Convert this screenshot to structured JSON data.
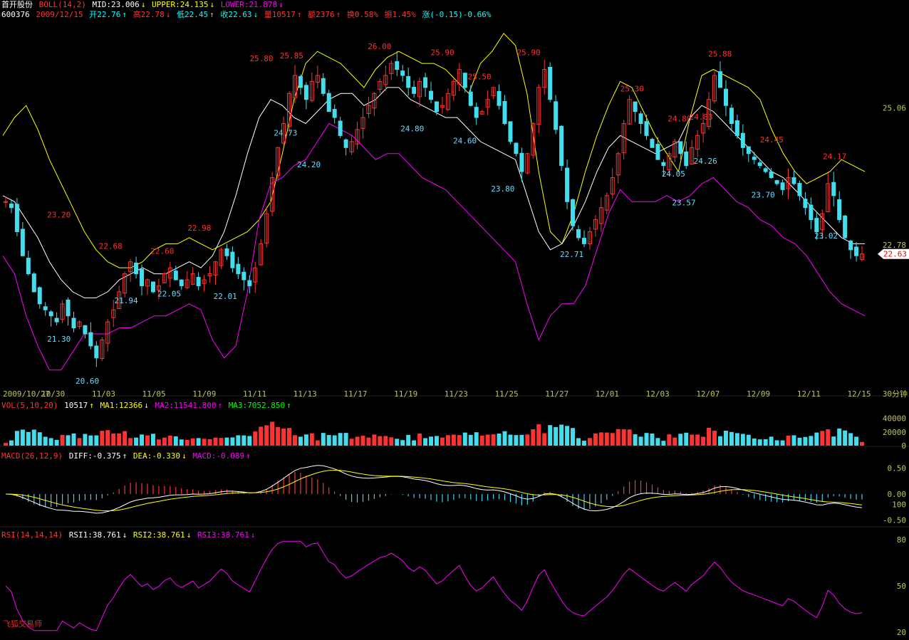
{
  "header": {
    "stock_name": "首开股份",
    "indicator": "BOLL(14,2)",
    "mid": "MID:23.006",
    "upper": "UPPER:24.135",
    "lower": "LOWER:21.878",
    "code": "600376",
    "date": "2009/12/15",
    "open": "开22.76",
    "high": "高22.78",
    "low": "低22.45",
    "close": "收22.63",
    "volume": "量10517",
    "amount": "额2376",
    "turnover": "换0.58%",
    "amplitude": "振1.45%",
    "change": "涨(-0.15)-0.66%"
  },
  "vol_header": {
    "name": "VOL(5,10,20)",
    "value": "10517",
    "ma1": "MA1:12366",
    "ma2": "MA2:11541.800",
    "ma3": "MA3:7052.850"
  },
  "macd_header": {
    "name": "MACD(26,12,9)",
    "diff": "DIFF:-0.375",
    "dea": "DEA:-0.330",
    "macd": "MACD:-0.089"
  },
  "rsi_header": {
    "name": "RSI(14,14,14)",
    "rsi1": "RSI1:38.761",
    "rsi2": "RSI2:38.761",
    "rsi3": "RSI3:38.761"
  },
  "period_label": "30分钟",
  "brand": "飞狐交易师",
  "colors": {
    "up": "#ff3333",
    "down": "#44ddee",
    "upper": "#ffff00",
    "mid": "#ffffff",
    "lower": "#ff00ff",
    "axis": "#c0c060",
    "macd_pos": "#ff3333",
    "macd_neg": "#44ccee"
  },
  "chart_data": [
    {
      "type": "candlestick",
      "name": "price",
      "x_labels": [
        "2009/10/27",
        "10/30",
        "11/03",
        "11/05",
        "11/09",
        "11/11",
        "11/13",
        "11/17",
        "11/19",
        "11/23",
        "11/25",
        "11/27",
        "12/01",
        "12/03",
        "12/07",
        "12/09",
        "12/11",
        "12/15"
      ],
      "ylim": [
        20.4,
        26.5
      ],
      "y_ticks": [
        25.06,
        22.78
      ],
      "current_price": 22.63,
      "extreme_labels": [
        {
          "text": "23.20",
          "kind": "high",
          "xi": 0.065,
          "v": 23.2
        },
        {
          "text": "21.30",
          "kind": "low",
          "xi": 0.065,
          "v": 21.3
        },
        {
          "text": "20.60",
          "kind": "low",
          "xi": 0.098,
          "v": 20.6
        },
        {
          "text": "22.68",
          "kind": "high",
          "xi": 0.125,
          "v": 22.68
        },
        {
          "text": "21.94",
          "kind": "low",
          "xi": 0.143,
          "v": 21.94
        },
        {
          "text": "22.60",
          "kind": "high",
          "xi": 0.185,
          "v": 22.6
        },
        {
          "text": "22.05",
          "kind": "low",
          "xi": 0.193,
          "v": 22.05
        },
        {
          "text": "22.98",
          "kind": "high",
          "xi": 0.228,
          "v": 22.98
        },
        {
          "text": "22.01",
          "kind": "low",
          "xi": 0.258,
          "v": 22.01
        },
        {
          "text": "25.80",
          "kind": "high",
          "xi": 0.3,
          "v": 25.8
        },
        {
          "text": "24.73",
          "kind": "low",
          "xi": 0.328,
          "v": 24.73
        },
        {
          "text": "25.85",
          "kind": "high",
          "xi": 0.335,
          "v": 25.85
        },
        {
          "text": "24.20",
          "kind": "low",
          "xi": 0.355,
          "v": 24.2
        },
        {
          "text": "26.00",
          "kind": "high",
          "xi": 0.437,
          "v": 26.0
        },
        {
          "text": "24.80",
          "kind": "low",
          "xi": 0.475,
          "v": 24.8
        },
        {
          "text": "25.90",
          "kind": "high",
          "xi": 0.51,
          "v": 25.9
        },
        {
          "text": "24.60",
          "kind": "low",
          "xi": 0.536,
          "v": 24.6
        },
        {
          "text": "25.50",
          "kind": "high",
          "xi": 0.553,
          "v": 25.5
        },
        {
          "text": "23.80",
          "kind": "low",
          "xi": 0.58,
          "v": 23.8
        },
        {
          "text": "25.90",
          "kind": "high",
          "xi": 0.61,
          "v": 25.9
        },
        {
          "text": "22.71",
          "kind": "low",
          "xi": 0.66,
          "v": 22.71
        },
        {
          "text": "25.30",
          "kind": "high",
          "xi": 0.73,
          "v": 25.3
        },
        {
          "text": "24.80",
          "kind": "high",
          "xi": 0.785,
          "v": 24.8
        },
        {
          "text": "24.05",
          "kind": "low",
          "xi": 0.778,
          "v": 24.05
        },
        {
          "text": "24.83",
          "kind": "high",
          "xi": 0.81,
          "v": 24.83
        },
        {
          "text": "23.57",
          "kind": "low",
          "xi": 0.79,
          "v": 23.57
        },
        {
          "text": "24.26",
          "kind": "low",
          "xi": 0.815,
          "v": 24.26
        },
        {
          "text": "25.88",
          "kind": "high",
          "xi": 0.832,
          "v": 25.88
        },
        {
          "text": "24.45",
          "kind": "high",
          "xi": 0.892,
          "v": 24.45
        },
        {
          "text": "23.70",
          "kind": "low",
          "xi": 0.882,
          "v": 23.7
        },
        {
          "text": "24.17",
          "kind": "high",
          "xi": 0.965,
          "v": 24.17
        },
        {
          "text": "23.02",
          "kind": "low",
          "xi": 0.955,
          "v": 23.02
        }
      ],
      "close_series": [
        23.5,
        23.4,
        23.0,
        22.6,
        22.3,
        22.0,
        21.8,
        21.7,
        21.6,
        21.5,
        21.8,
        21.6,
        21.4,
        21.5,
        21.3,
        21.1,
        20.9,
        21.2,
        21.5,
        21.7,
        22.0,
        22.3,
        22.5,
        22.3,
        22.1,
        22.2,
        22.0,
        22.1,
        22.3,
        22.4,
        22.2,
        22.1,
        22.2,
        22.3,
        22.1,
        22.2,
        22.3,
        22.5,
        22.7,
        22.6,
        22.4,
        22.3,
        22.2,
        22.1,
        22.4,
        22.8,
        23.3,
        23.9,
        24.4,
        24.8,
        25.3,
        25.6,
        25.4,
        25.2,
        25.5,
        25.6,
        25.3,
        25.0,
        24.9,
        24.6,
        24.4,
        24.5,
        24.7,
        24.9,
        25.1,
        25.3,
        25.5,
        25.6,
        25.8,
        25.7,
        25.6,
        25.4,
        25.3,
        25.5,
        25.4,
        25.2,
        25.0,
        25.1,
        25.3,
        25.5,
        25.7,
        25.4,
        25.1,
        24.9,
        25.0,
        25.2,
        25.4,
        25.1,
        24.8,
        24.5,
        24.3,
        24.0,
        24.3,
        24.8,
        25.4,
        25.7,
        25.2,
        24.7,
        24.1,
        23.5,
        23.1,
        22.9,
        22.8,
        23.0,
        23.2,
        23.4,
        23.6,
        23.9,
        24.3,
        24.8,
        25.2,
        25.0,
        24.8,
        24.6,
        24.4,
        24.2,
        24.1,
        24.3,
        24.5,
        24.3,
        24.1,
        24.4,
        24.6,
        24.8,
        25.2,
        25.6,
        25.4,
        25.1,
        24.8,
        24.6,
        24.4,
        24.3,
        24.2,
        24.1,
        24.0,
        23.9,
        23.8,
        23.7,
        23.9,
        23.8,
        23.6,
        23.4,
        23.2,
        23.0,
        23.3,
        23.8,
        23.6,
        23.2,
        22.9,
        22.7,
        22.6,
        22.63
      ],
      "upper_series": [
        24.6,
        24.9,
        25.1,
        24.7,
        24.2,
        23.8,
        23.4,
        23.0,
        22.7,
        22.5,
        22.4,
        22.4,
        22.5,
        22.7,
        22.8,
        22.8,
        22.9,
        22.8,
        22.7,
        22.8,
        22.9,
        23.0,
        23.2,
        23.5,
        24.3,
        25.2,
        25.8,
        26.0,
        25.9,
        25.8,
        25.6,
        25.4,
        25.7,
        25.9,
        26.0,
        25.9,
        25.8,
        25.8,
        25.7,
        25.5,
        25.3,
        25.8,
        26.0,
        26.3,
        26.1,
        25.3,
        24.0,
        23.0,
        22.8,
        23.3,
        24.0,
        24.6,
        25.1,
        25.5,
        25.4,
        25.0,
        24.6,
        24.3,
        24.0,
        24.9,
        25.6,
        25.7,
        25.6,
        25.5,
        25.4,
        25.2,
        24.7,
        24.3,
        24.0,
        23.8,
        23.9,
        24.0,
        24.2,
        24.1,
        24.0
      ],
      "mid_series": [
        23.6,
        23.5,
        23.2,
        22.9,
        22.5,
        22.2,
        22.0,
        21.9,
        21.9,
        22.0,
        22.2,
        22.3,
        22.4,
        22.3,
        22.3,
        22.4,
        22.5,
        22.4,
        22.6,
        23.0,
        23.6,
        24.3,
        24.9,
        25.2,
        25.1,
        24.9,
        24.8,
        25.0,
        25.2,
        25.3,
        25.3,
        25.1,
        25.2,
        25.4,
        25.4,
        25.2,
        25.1,
        25.0,
        24.9,
        24.9,
        24.7,
        24.5,
        24.4,
        24.3,
        24.2,
        23.6,
        23.0,
        22.7,
        22.8,
        23.1,
        23.5,
        24.0,
        24.4,
        24.6,
        24.5,
        24.4,
        24.3,
        24.4,
        24.5,
        24.9,
        25.1,
        25.0,
        24.8,
        24.6,
        24.4,
        24.2,
        24.0,
        23.9,
        23.7,
        23.5,
        23.3,
        23.1,
        22.9,
        22.8,
        22.8
      ],
      "lower_series": [
        22.6,
        22.3,
        21.6,
        21.1,
        20.7,
        20.7,
        21.0,
        21.3,
        21.3,
        21.3,
        21.4,
        21.4,
        21.5,
        21.6,
        21.6,
        21.7,
        21.8,
        21.7,
        21.2,
        20.9,
        21.1,
        22.0,
        23.2,
        23.8,
        23.9,
        24.1,
        24.2,
        24.5,
        24.8,
        24.7,
        24.6,
        24.4,
        24.2,
        24.3,
        24.3,
        24.1,
        23.9,
        23.8,
        23.7,
        23.5,
        23.3,
        23.1,
        22.9,
        22.7,
        22.5,
        21.8,
        21.2,
        21.6,
        21.8,
        21.8,
        22.1,
        22.7,
        23.3,
        23.7,
        23.5,
        23.5,
        23.5,
        23.6,
        23.5,
        23.6,
        23.8,
        23.9,
        23.7,
        23.5,
        23.4,
        23.2,
        23.1,
        22.9,
        22.8,
        22.6,
        22.3,
        22.0,
        21.8,
        21.7,
        21.6
      ]
    },
    {
      "type": "bar",
      "name": "volume",
      "y_ticks": [
        40000,
        20000,
        0
      ],
      "ylim": [
        0,
        50000
      ]
    },
    {
      "type": "bar",
      "name": "macd",
      "y_ticks": [
        0.5,
        0.0,
        -0.5
      ],
      "extra_tick": "100",
      "ylim": [
        -0.6,
        0.6
      ]
    },
    {
      "type": "line",
      "name": "rsi",
      "y_ticks": [
        80,
        50,
        20
      ],
      "ylim": [
        20,
        80
      ]
    }
  ]
}
